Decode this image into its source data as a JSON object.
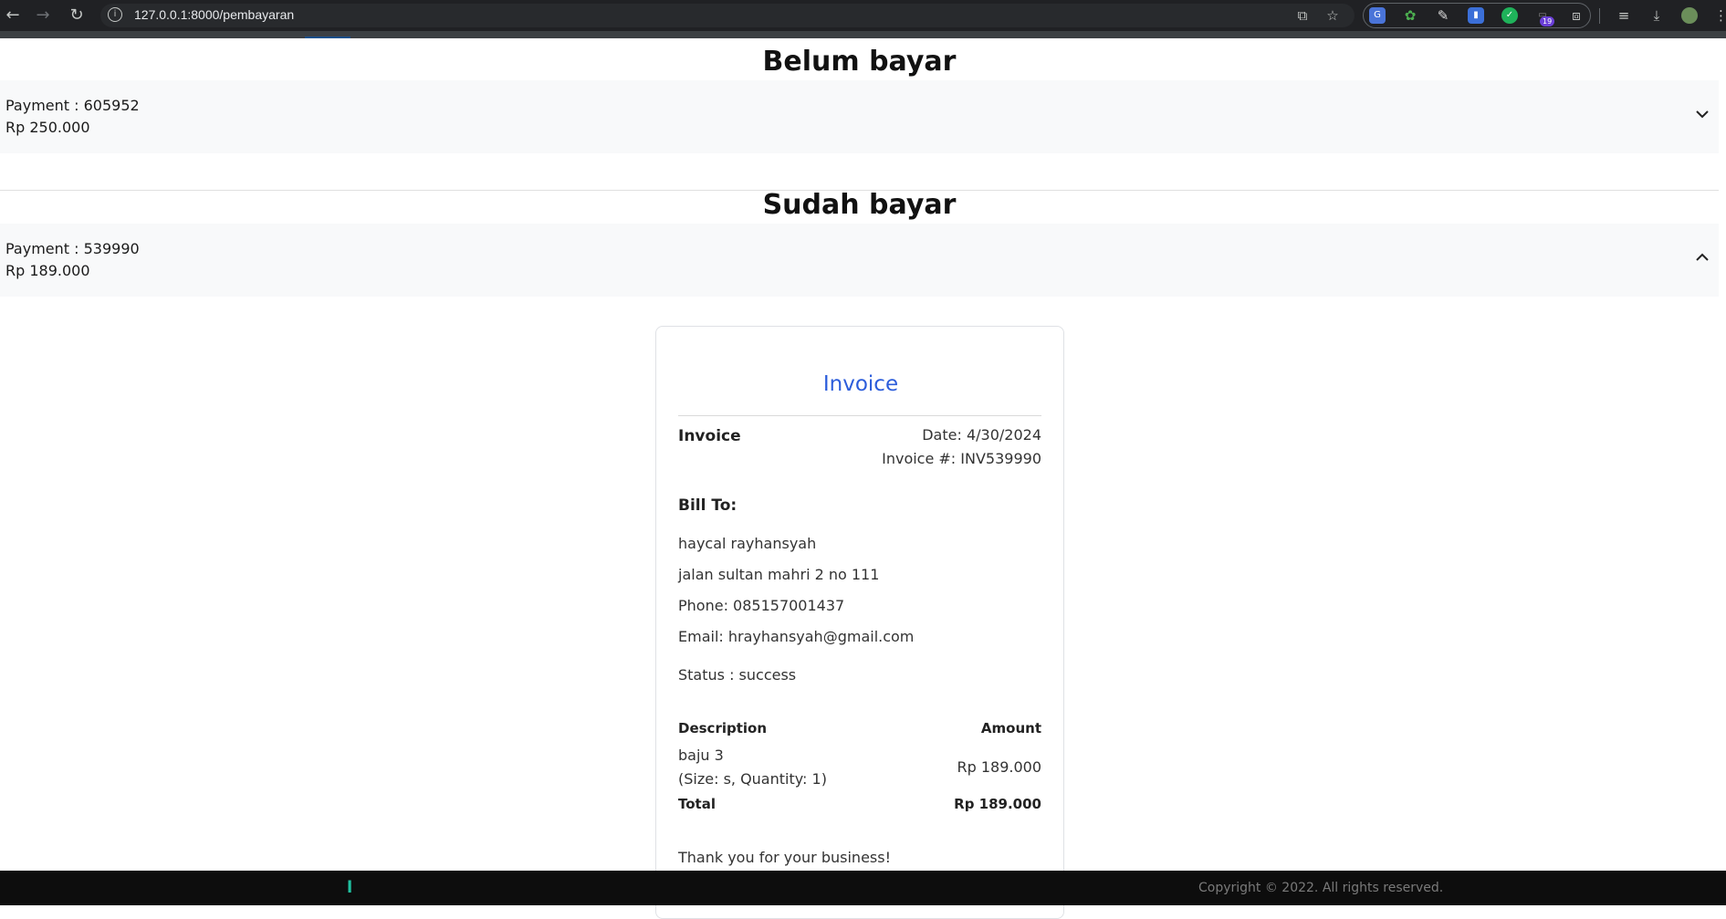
{
  "browser": {
    "url": "127.0.0.1:8000/pembayaran",
    "extension_badge": "19"
  },
  "unpaid": {
    "heading": "Belum bayar",
    "payment_label": "Payment : 605952",
    "amount": "Rp 250.000"
  },
  "paid": {
    "heading": "Sudah bayar",
    "payment_label": "Payment : 539990",
    "amount": "Rp 189.000"
  },
  "invoice": {
    "title": "Invoice",
    "label": "Invoice",
    "date": "Date: 4/30/2024",
    "number": "Invoice #: INV539990",
    "bill_to_heading": "Bill To:",
    "customer_name": "haycal rayhansyah",
    "address": "jalan sultan mahri 2 no 111",
    "phone": "Phone: 085157001437",
    "email": "Email: hrayhansyah@gmail.com",
    "status": "Status : success",
    "table": {
      "col_description": "Description",
      "col_amount": "Amount",
      "item_name": "baju 3",
      "item_detail": "(Size: s, Quantity: 1)",
      "item_amount": "Rp 189.000",
      "total_label": "Total",
      "total_amount": "Rp 189.000"
    },
    "thanks": "Thank you for your business!"
  },
  "footer": {
    "logo_char": "l",
    "copyright": "Copyright © 2022. All rights reserved."
  }
}
